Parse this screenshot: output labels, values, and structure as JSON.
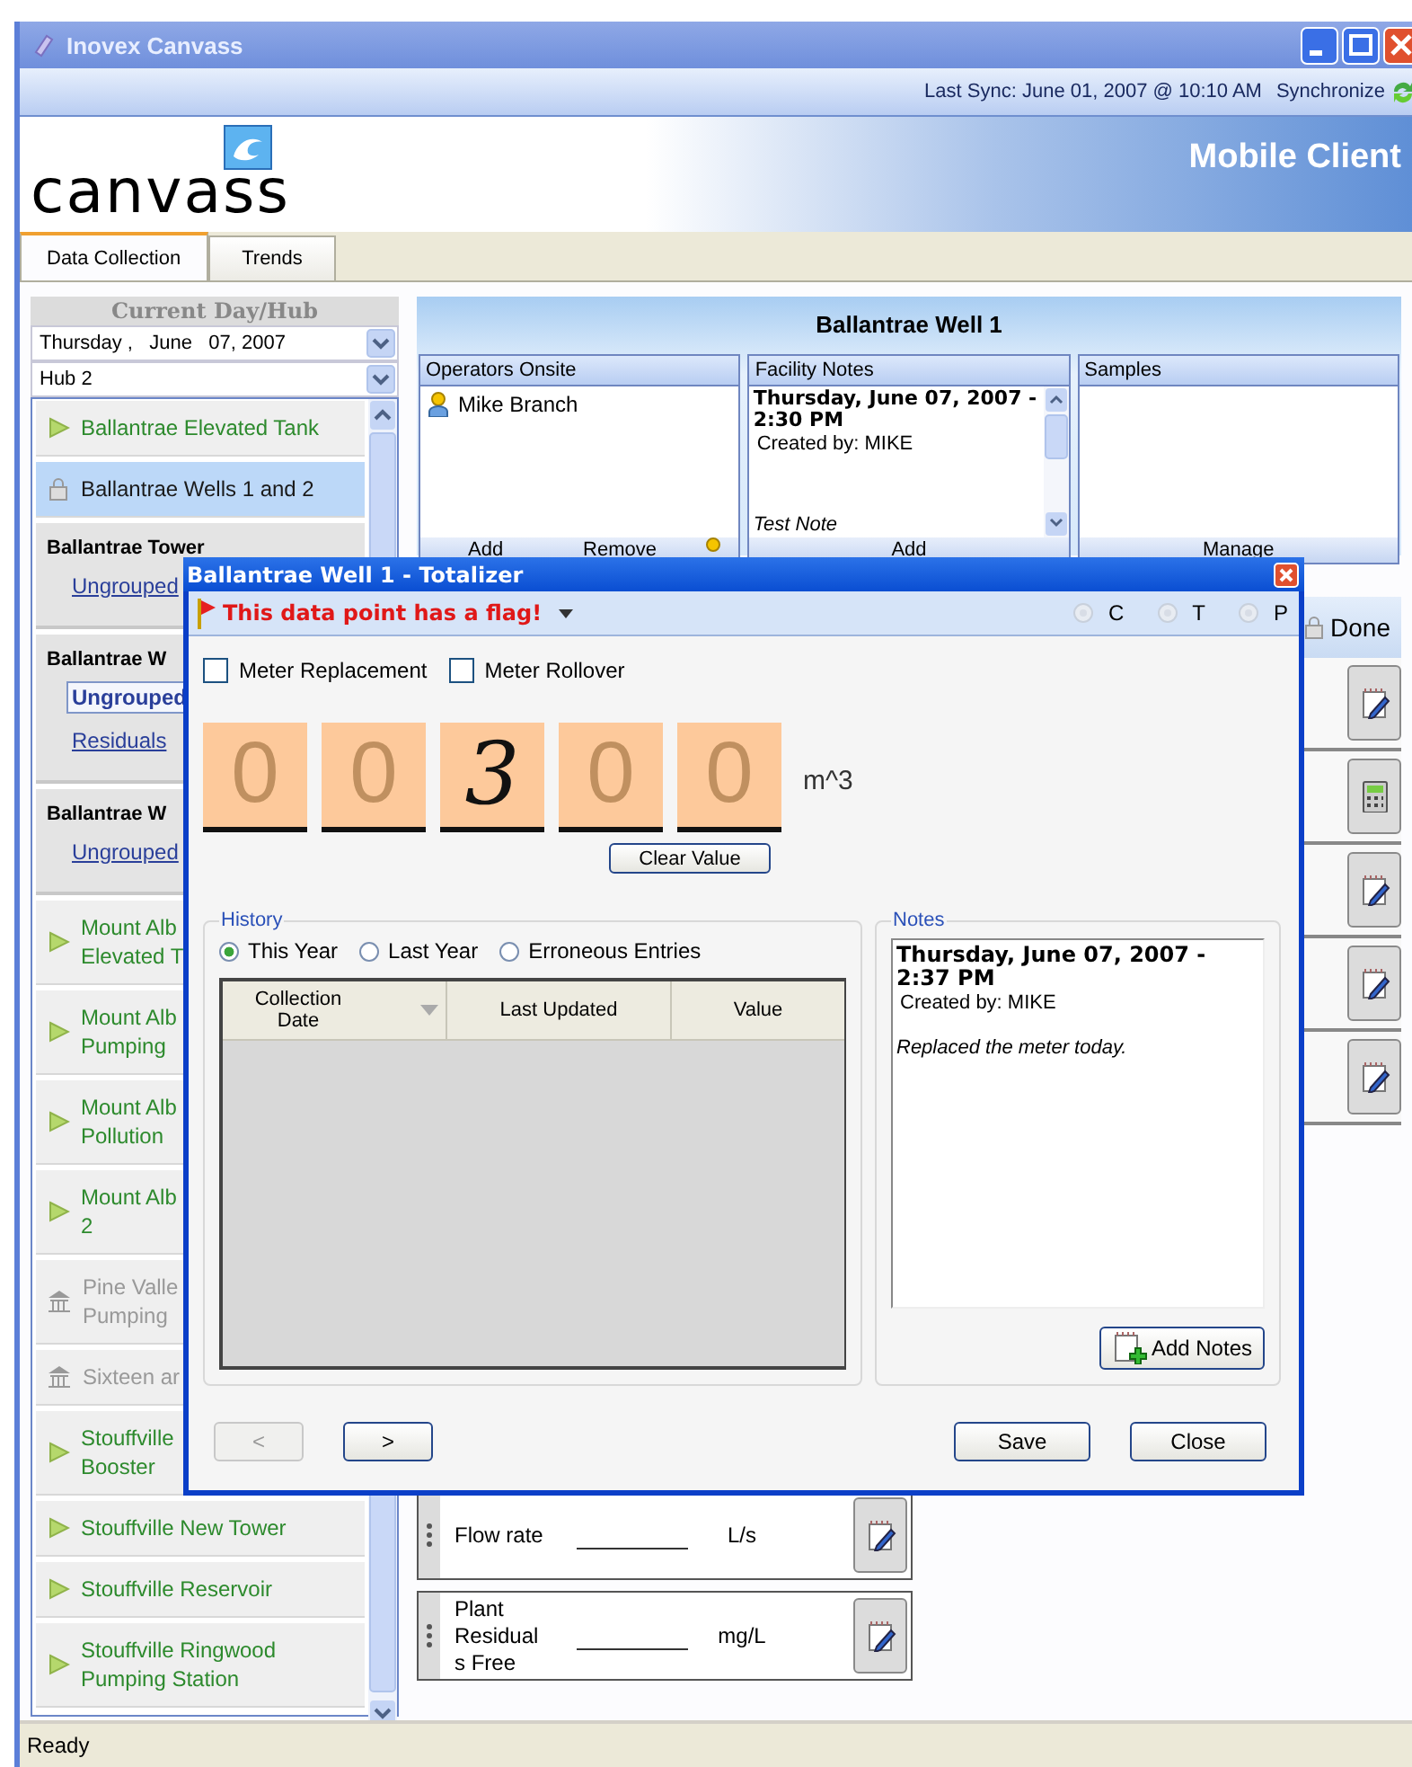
{
  "window": {
    "title": "Inovex Canvass"
  },
  "sync_bar": {
    "last_sync": "Last Sync: June 01, 2007 @ 10:10 AM",
    "synchronize": "Synchronize"
  },
  "banner": {
    "logo": "canvass",
    "subtitle": "Mobile Client"
  },
  "tabs": [
    {
      "label": "Data Collection",
      "selected": true
    },
    {
      "label": "Trends",
      "selected": false
    }
  ],
  "sidebar": {
    "header": "Current Day/Hub",
    "date": "Thursday ,   June   07, 2007",
    "hub": "Hub 2",
    "items": [
      {
        "kind": "facility",
        "label": "Ballantrae Elevated Tank",
        "locked": false,
        "inactive": false,
        "selected": false
      },
      {
        "kind": "facility",
        "label": "Ballantrae Wells 1 and 2",
        "locked": true,
        "inactive": false,
        "selected": true
      },
      {
        "kind": "group",
        "title": "Ballantrae Tower",
        "links": [
          {
            "label": "Ungrouped",
            "selected": false
          }
        ]
      },
      {
        "kind": "group",
        "title": "Ballantrae W",
        "links": [
          {
            "label": "Ungrouped",
            "selected": true
          },
          {
            "label": "Residuals",
            "selected": false
          }
        ]
      },
      {
        "kind": "group",
        "title": "Ballantrae W",
        "links": [
          {
            "label": "Ungrouped",
            "selected": false
          }
        ]
      },
      {
        "kind": "facility",
        "label": "Mount Alb\nElevated T",
        "locked": false,
        "inactive": false,
        "selected": false
      },
      {
        "kind": "facility",
        "label": "Mount Alb\nPumping",
        "locked": false,
        "inactive": false,
        "selected": false
      },
      {
        "kind": "facility",
        "label": "Mount Alb\nPollution",
        "locked": false,
        "inactive": false,
        "selected": false
      },
      {
        "kind": "facility",
        "label": "Mount Alb\n2",
        "locked": false,
        "inactive": false,
        "selected": false
      },
      {
        "kind": "facility",
        "label": "Pine Valle\nPumping",
        "locked": false,
        "inactive": true,
        "selected": false
      },
      {
        "kind": "facility",
        "label": "Sixteen ar",
        "locked": false,
        "inactive": true,
        "selected": false
      },
      {
        "kind": "facility",
        "label": "Stouffville\nBooster",
        "locked": false,
        "inactive": false,
        "selected": false
      },
      {
        "kind": "facility",
        "label": "Stouffville New Tower",
        "locked": false,
        "inactive": false,
        "selected": false
      },
      {
        "kind": "facility",
        "label": "Stouffville Reservoir",
        "locked": false,
        "inactive": false,
        "selected": false
      },
      {
        "kind": "facility",
        "label": "Stouffville Ringwood\nPumping Station",
        "locked": false,
        "inactive": false,
        "selected": false
      }
    ]
  },
  "main": {
    "title": "Ballantrae Well 1",
    "operators": {
      "header": "Operators Onsite",
      "people": [
        "Mike Branch"
      ],
      "buttons": [
        "Add",
        "Remove"
      ]
    },
    "facility_notes": {
      "header": "Facility Notes",
      "title": "Thursday, June 07, 2007 - 2:30 PM",
      "author": "Created by: MIKE",
      "text": "Test Note",
      "button": "Add"
    },
    "samples": {
      "header": "Samples",
      "button": "Manage"
    },
    "done": "Done",
    "points": [
      {
        "kind": "note"
      },
      {
        "kind": "calculator"
      },
      {
        "kind": "note"
      },
      {
        "kind": "note"
      },
      {
        "kind": "note"
      }
    ],
    "lower_points": [
      {
        "kind": "note",
        "label": "Flow rate",
        "unit": "L/s"
      },
      {
        "kind": "note",
        "label": "Plant\nResidual\ns Free",
        "unit": "mg/L"
      }
    ]
  },
  "dialog": {
    "title": "Ballantrae Well 1 - Totalizer",
    "flag": "This data point has a flag!",
    "indicators": [
      {
        "label": "C"
      },
      {
        "label": "T"
      },
      {
        "label": "P"
      }
    ],
    "checkboxes": [
      {
        "label": "Meter Replacement",
        "checked": false
      },
      {
        "label": "Meter Rollover",
        "checked": false
      }
    ],
    "digits": [
      {
        "text": "0",
        "written": false
      },
      {
        "text": "0",
        "written": false
      },
      {
        "text": "3",
        "written": true
      },
      {
        "text": "0",
        "written": false
      },
      {
        "text": "0",
        "written": false
      }
    ],
    "unit": "m^3",
    "clear_button": "Clear Value",
    "history": {
      "legend": "History",
      "filters": [
        {
          "label": "This Year",
          "selected": true
        },
        {
          "label": "Last Year",
          "selected": false
        },
        {
          "label": "Erroneous Entries",
          "selected": false
        }
      ],
      "columns": [
        "Collection Date",
        "Last Updated",
        "Value"
      ]
    },
    "notes": {
      "legend": "Notes",
      "title": "Thursday, June 07, 2007 - 2:37 PM",
      "author": "Created by: MIKE",
      "text": "Replaced the meter today.",
      "button": "Add Notes"
    },
    "nav": [
      {
        "label": "<",
        "disabled": true
      },
      {
        "label": ">",
        "disabled": false
      }
    ],
    "buttons": [
      "Save",
      "Close"
    ]
  },
  "status_bar": "Ready"
}
